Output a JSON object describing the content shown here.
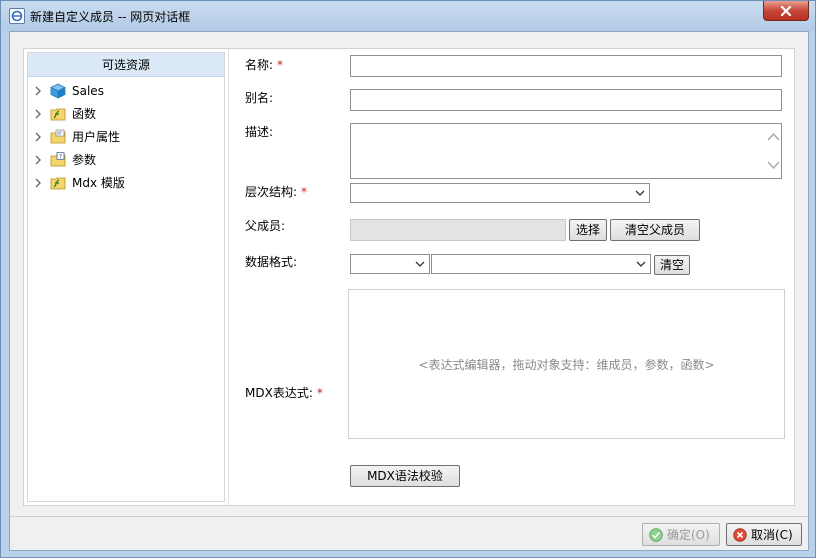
{
  "window": {
    "title": "新建自定义成员 -- 网页对话框",
    "close_symbol": "✕"
  },
  "tree": {
    "header": "可选资源",
    "items": [
      {
        "label": "Sales",
        "icon": "cube-icon"
      },
      {
        "label": "函数",
        "icon": "function-folder-icon"
      },
      {
        "label": "用户属性",
        "icon": "user-property-folder-icon"
      },
      {
        "label": "参数",
        "icon": "parameter-folder-icon"
      },
      {
        "label": "Mdx 模版",
        "icon": "mdx-template-folder-icon"
      }
    ]
  },
  "form": {
    "name_label": "名称:",
    "alias_label": "别名:",
    "desc_label": "描述:",
    "hierarchy_label": "层次结构:",
    "parent_label": "父成员:",
    "format_label": "数据格式:",
    "mdx_label": "MDX表达式:",
    "required_mark": "*",
    "name_value": "",
    "alias_value": "",
    "desc_value": "",
    "hierarchy_value": "",
    "parent_value": "",
    "format_value_1": "",
    "format_value_2": "",
    "select_button": "选择",
    "clear_parent_button": "清空父成员",
    "clear_format_button": "清空",
    "editor_hint": "<表达式编辑器，拖动对象支持：维成员，参数，函数>",
    "validate_button": "MDX语法校验"
  },
  "footer": {
    "ok_button": "确定(O)",
    "cancel_button": "取消(C)"
  },
  "colors": {
    "required": "#d21f1f",
    "tree_header_bg": "#dbe8f6",
    "titlebar": "#b9d1ea"
  }
}
